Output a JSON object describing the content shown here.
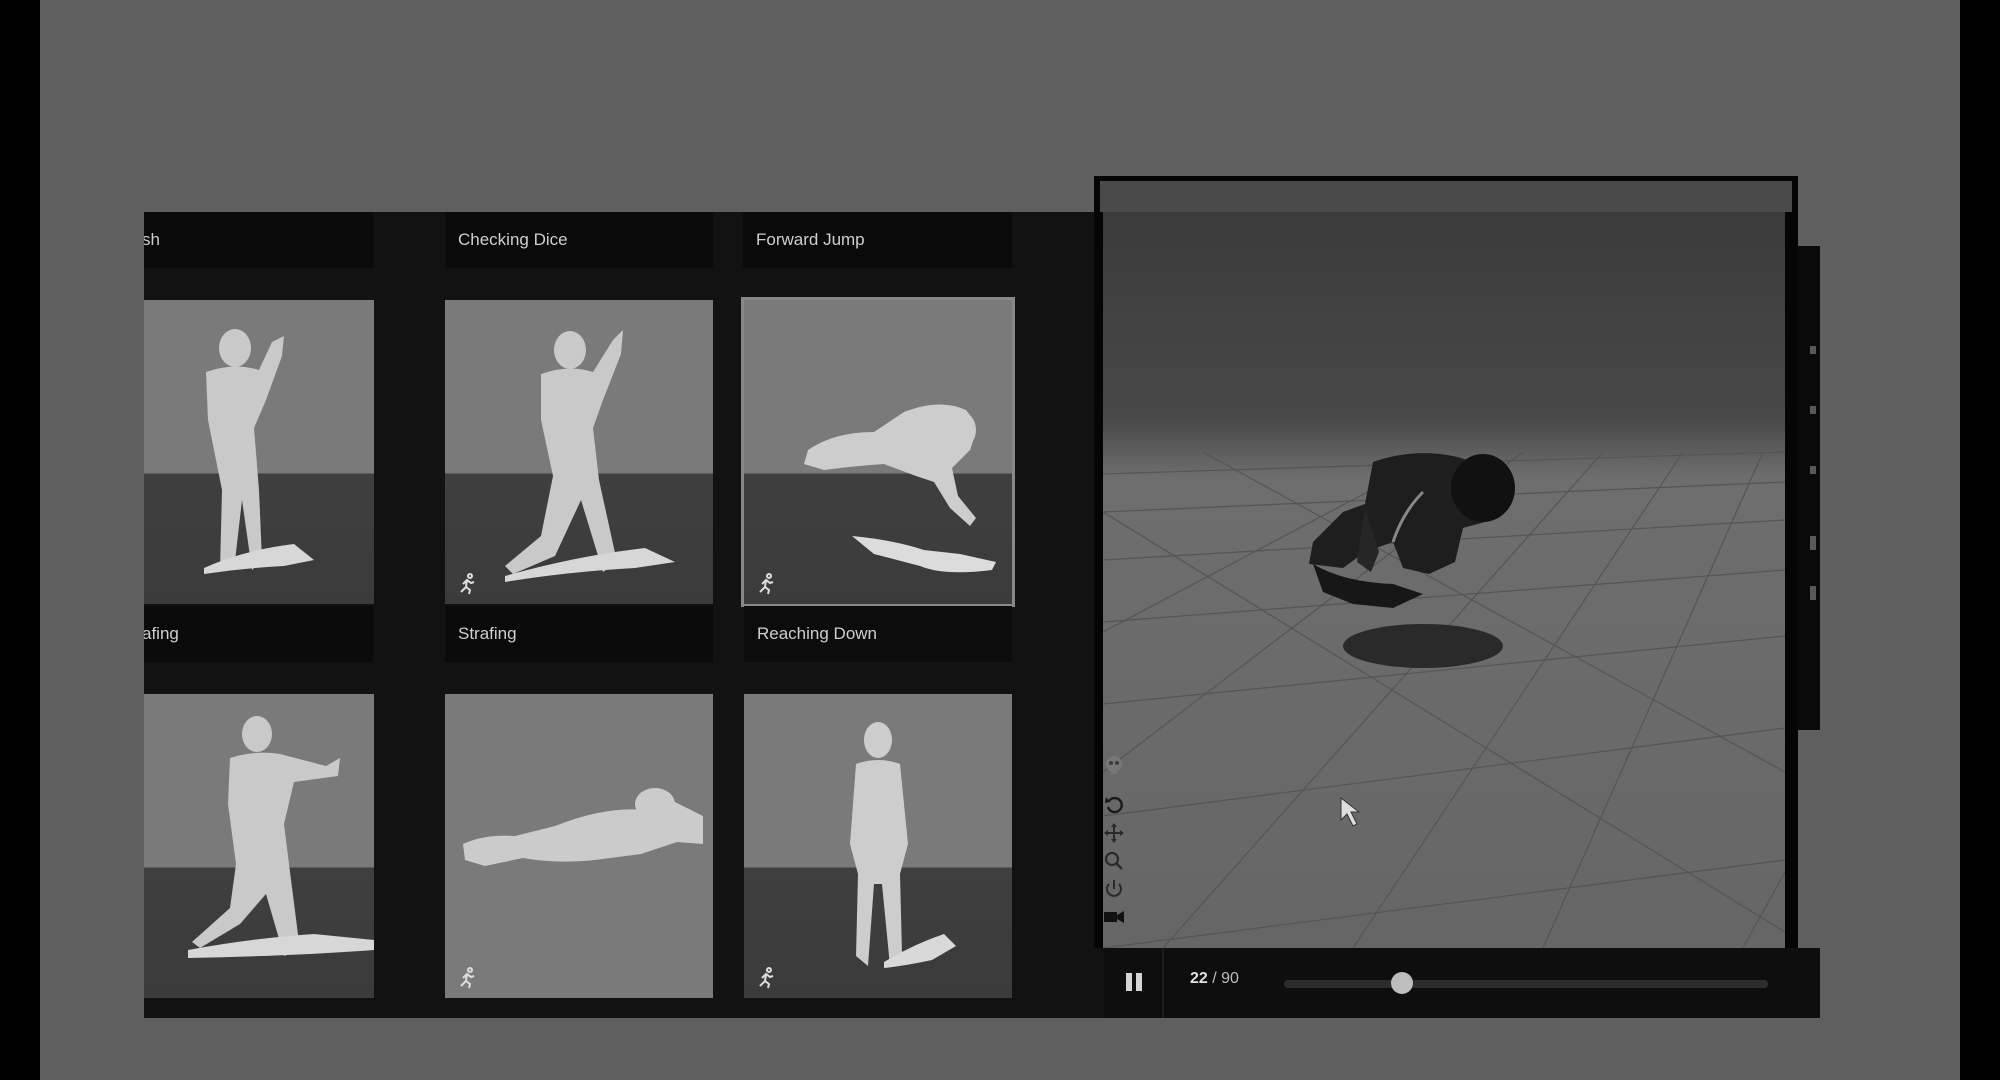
{
  "grid": {
    "top_labels": [
      "sh",
      "Checking Dice",
      "Forward Jump"
    ],
    "middle_labels": [
      "afing",
      "Strafing",
      "Reaching Down"
    ],
    "selected_card": "Reaching Down"
  },
  "icons": {
    "card_badge": "running-person-icon",
    "tools": [
      "skeleton-icon",
      "reset-icon",
      "move-icon",
      "zoom-icon",
      "power-icon",
      "camera-icon"
    ],
    "play": "pause-icon"
  },
  "playback": {
    "current_frame": "22",
    "separator": "/",
    "total_frames": "90",
    "progress": 0.244
  },
  "colors": {
    "background": "#5f5f5f",
    "panel": "#121212",
    "label_text": "#cfcfcf"
  }
}
